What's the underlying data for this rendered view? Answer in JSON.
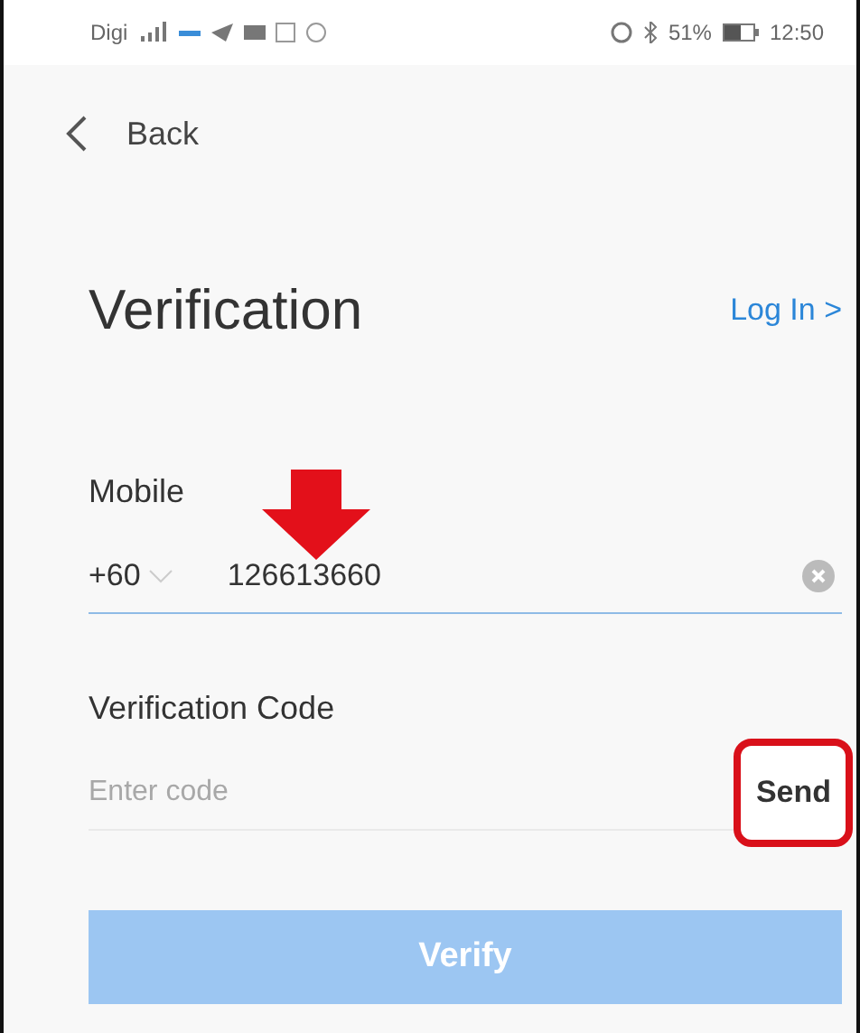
{
  "status_bar": {
    "carrier": "Digi",
    "battery": "51%",
    "time": "12:50"
  },
  "nav": {
    "back_label": "Back"
  },
  "title": "Verification",
  "login_link": "Log In >",
  "mobile": {
    "label": "Mobile",
    "country_code": "+60",
    "value": "126613660"
  },
  "code": {
    "label": "Verification Code",
    "placeholder": "Enter code",
    "send_label": "Send"
  },
  "verify_button": {
    "label": "Verify",
    "disabled": true
  }
}
